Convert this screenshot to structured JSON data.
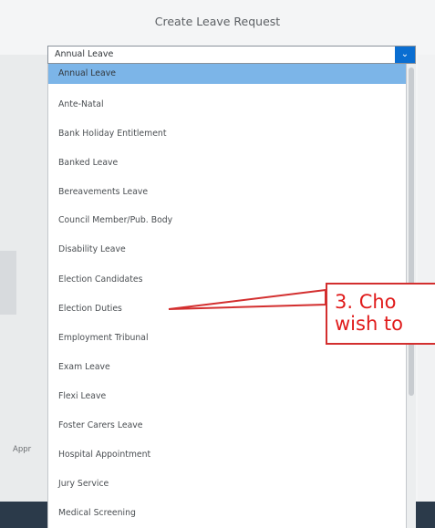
{
  "dialog": {
    "title": "Create Leave Request"
  },
  "leave_type_select": {
    "value": "Annual Leave",
    "options": [
      "Annual Leave",
      "Ante-Natal",
      "Bank Holiday Entitlement",
      "Banked Leave",
      "Bereavements Leave",
      "Council Member/Pub. Body",
      "Disability Leave",
      "Election Candidates",
      "Election Duties",
      "Employment Tribunal",
      "Exam Leave",
      "Flexi Leave",
      "Foster Carers Leave",
      "Hospital Appointment",
      "Jury Service",
      "Medical Screening"
    ],
    "selected_index": 0
  },
  "background": {
    "partial_label": "Appr"
  },
  "callout": {
    "line1": "3. Cho",
    "line2": "wish to"
  },
  "colors": {
    "accent": "#0a6ed1",
    "selected_row": "#7cb5e8",
    "callout_red": "#d32f2f"
  }
}
